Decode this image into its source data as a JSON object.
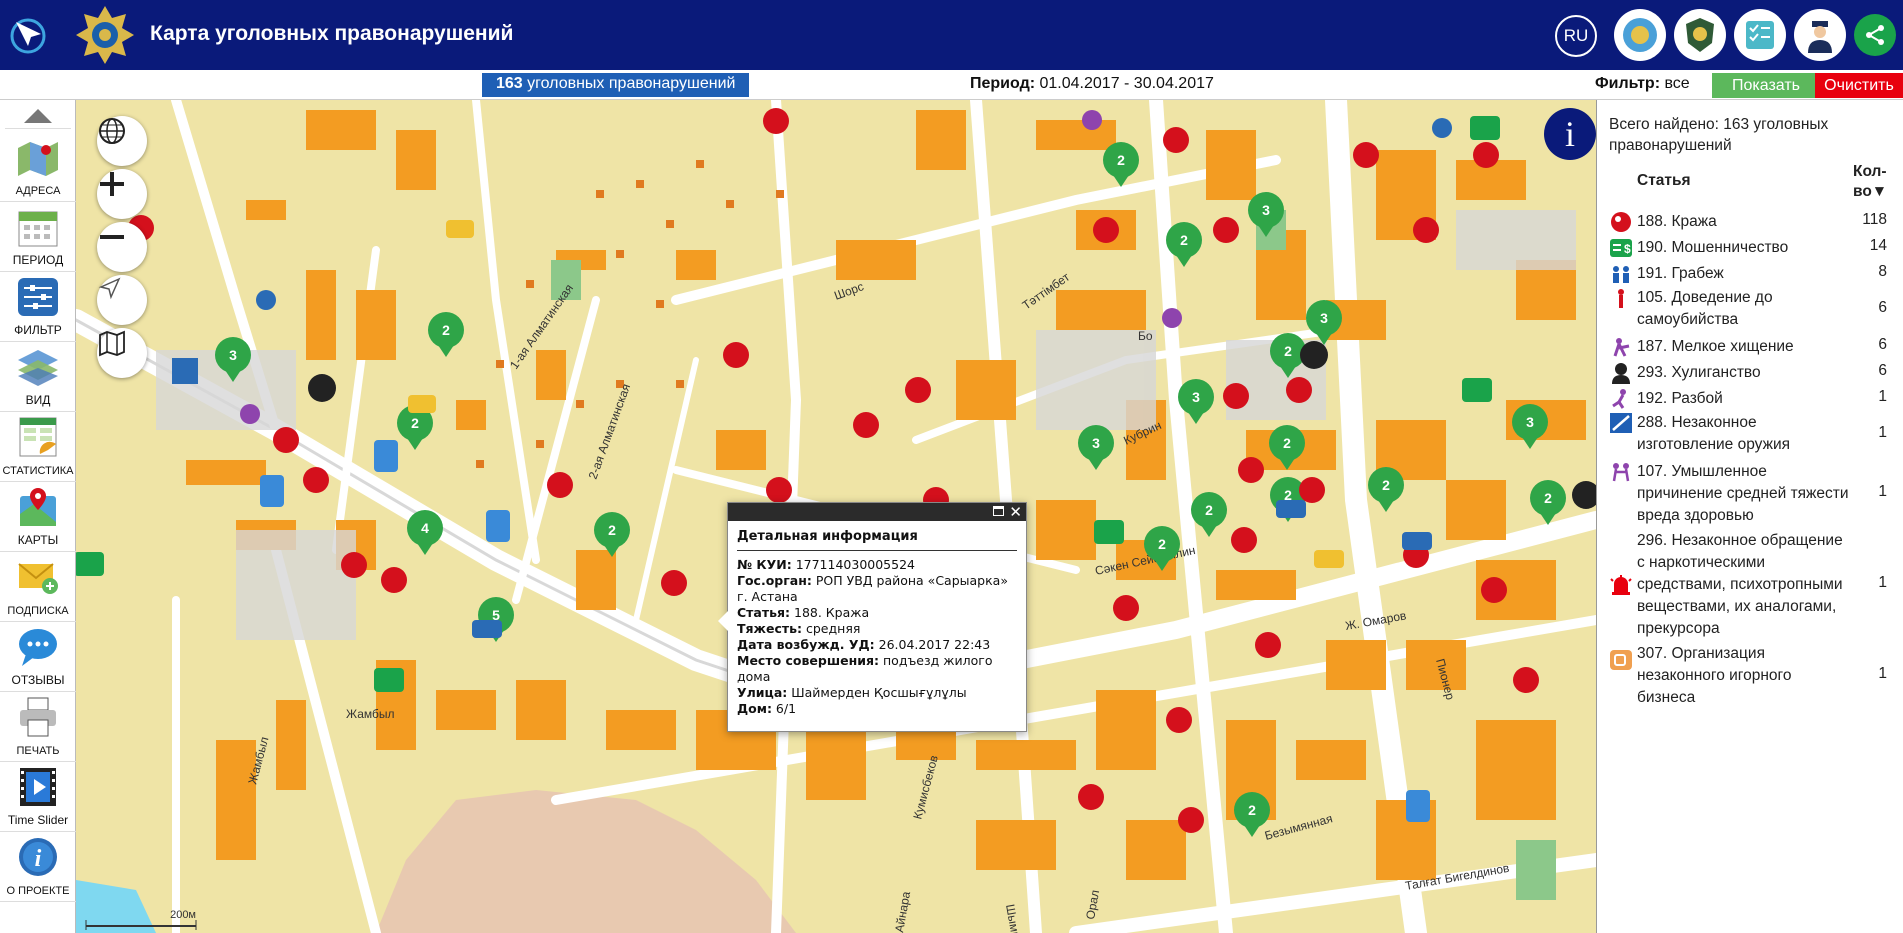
{
  "header": {
    "title": "Карта уголовных правонарушений",
    "lang": "RU",
    "icons": [
      "arrow-logo-icon",
      "emblem-icon",
      "kz-emblem-icon",
      "police-badge-icon",
      "checklist-icon",
      "officer-icon",
      "share-icon"
    ]
  },
  "infobar": {
    "count": "163",
    "count_label": " уголовных правонарушений",
    "period_label": "Период:",
    "period_value": " 01.04.2017 - 30.04.2017",
    "filter_label": "Фильтр:",
    "filter_value": " все",
    "show_button": "Показать",
    "clear_button": "Очистить"
  },
  "sidebar": {
    "items": [
      {
        "label": "АДРЕСА",
        "icon": "map-address-icon"
      },
      {
        "label": "ПЕРИОД",
        "icon": "calendar-icon"
      },
      {
        "label": "ФИЛЬТР",
        "icon": "filter-sliders-icon"
      },
      {
        "label": "ВИД",
        "icon": "layers-icon"
      },
      {
        "label": "СТАТИСТИКА",
        "icon": "statistics-icon"
      },
      {
        "label": "КАРТЫ",
        "icon": "maps-pin-icon"
      },
      {
        "label": "ПОДПИСКА",
        "icon": "subscribe-mail-icon"
      },
      {
        "label": "ОТЗЫВЫ",
        "icon": "feedback-chat-icon"
      },
      {
        "label": "ПЕЧАТЬ",
        "icon": "printer-icon"
      },
      {
        "label": "Time Slider",
        "icon": "film-play-icon"
      },
      {
        "label": "О ПРОЕКТЕ",
        "icon": "info-icon"
      }
    ]
  },
  "map": {
    "scale_label": "200м",
    "street_labels": [
      "Шорс",
      "Жамбыл",
      "Сәкен Сейфуллин",
      "Ж. Омаров",
      "Пионер",
      "Безымянная",
      "Талғат Бигелдинов",
      "Кубрин",
      "Тәттімбет",
      "1-ая Алматинская",
      "2-ая Алматинская",
      "Кумисбеков",
      "Айнара",
      "Шымкент",
      "Орал",
      "Жамбыл",
      "Бо"
    ],
    "clusters": [
      "3",
      "2",
      "2",
      "4",
      "2",
      "5",
      "2",
      "3",
      "2",
      "3",
      "3",
      "2",
      "2",
      "2",
      "2",
      "3",
      "2",
      "2",
      "2",
      "2",
      "3"
    ]
  },
  "popup": {
    "title": "Детальная информация",
    "fields": [
      {
        "label": "№ КУИ:",
        "value": " 177114030005524"
      },
      {
        "label": "Гос.орган:",
        "value": " РОП УВД района «Сарыарка» г. Астана"
      },
      {
        "label": "Статья:",
        "value": " 188. Кража"
      },
      {
        "label": "Тяжесть:",
        "value": " средняя"
      },
      {
        "label": "Дата возбужд. УД:",
        "value": " 26.04.2017 22:43"
      },
      {
        "label": "Место совершения:",
        "value": " подъезд жилого дома"
      },
      {
        "label": "Улица:",
        "value": " Шаймерден Қосшығұлұлы"
      },
      {
        "label": "Дом:",
        "value": " 6/1"
      }
    ]
  },
  "panel": {
    "total": "Всего найдено: 163 уголовных правонарушений",
    "col_article": "Статья",
    "col_count": "Кол-во▼",
    "rows": [
      {
        "label": "188. Кража",
        "count": "118",
        "icon": "thief-icon",
        "color": "#d4101c"
      },
      {
        "label": "190. Мошенничество",
        "count": "14",
        "icon": "fraud-money-icon",
        "color": "#1aa34a"
      },
      {
        "label": "191. Грабеж",
        "count": "8",
        "icon": "robbery-icon",
        "color": "#1f5fb5"
      },
      {
        "label": "105. Доведение до самоубийства",
        "count": "6",
        "icon": "suicide-icon",
        "color": "#d4101c"
      },
      {
        "label": "187. Мелкое хищение",
        "count": "6",
        "icon": "petty-theft-icon",
        "color": "#8e44ad"
      },
      {
        "label": "293. Хулиганство",
        "count": "6",
        "icon": "hooligan-icon",
        "color": "#222222"
      },
      {
        "label": "192. Разбой",
        "count": "1",
        "icon": "assault-icon",
        "color": "#8e44ad"
      },
      {
        "label": "288. Незаконное изготовление оружия",
        "count": "1",
        "icon": "weapon-icon",
        "color": "#1f5fb5"
      },
      {
        "label": "107. Умышленное причинение средней тяжести вреда здоровью",
        "count": "1",
        "icon": "harm-icon",
        "color": "#8e44ad"
      },
      {
        "label": "296. Незаконное обращение с наркотическими средствами, психотропными веществами, их аналогами, прекурсора",
        "count": "1",
        "icon": "drugs-siren-icon",
        "color": "#e8000e"
      },
      {
        "label": "307. Организация незаконного игорного бизнеса",
        "count": "1",
        "icon": "gambling-dice-icon",
        "color": "#f0a050"
      }
    ]
  }
}
